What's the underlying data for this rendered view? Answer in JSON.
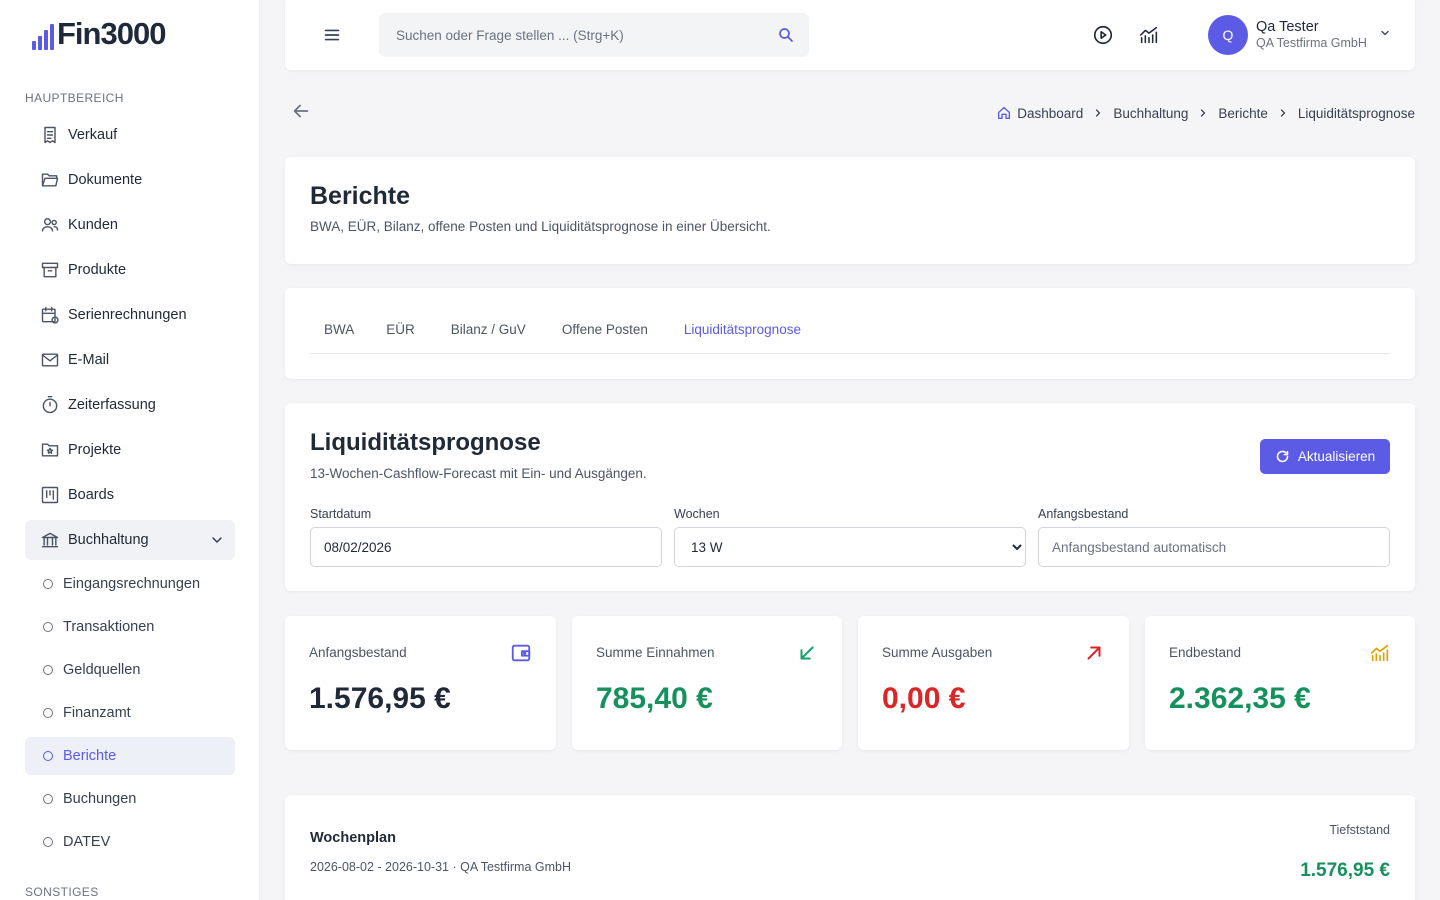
{
  "app": {
    "logo_text": "Fin3000"
  },
  "sidebar": {
    "section_main": "HAUPTBEREICH",
    "items": [
      {
        "label": "Verkauf"
      },
      {
        "label": "Dokumente"
      },
      {
        "label": "Kunden"
      },
      {
        "label": "Produkte"
      },
      {
        "label": "Serienrechnungen"
      },
      {
        "label": "E-Mail"
      },
      {
        "label": "Zeiterfassung"
      },
      {
        "label": "Projekte"
      },
      {
        "label": "Boards"
      },
      {
        "label": "Buchhaltung"
      }
    ],
    "sub_items": [
      {
        "label": "Eingangsrechnungen"
      },
      {
        "label": "Transaktionen"
      },
      {
        "label": "Geldquellen"
      },
      {
        "label": "Finanzamt"
      },
      {
        "label": "Berichte"
      },
      {
        "label": "Buchungen"
      },
      {
        "label": "DATEV"
      }
    ],
    "section_other": "SONSTIGES"
  },
  "topbar": {
    "search_placeholder": "Suchen oder Frage stellen ... (Strg+K)",
    "user": {
      "initial": "Q",
      "name": "Qa Tester",
      "company": "QA Testfirma GmbH"
    }
  },
  "breadcrumb": [
    "Dashboard",
    "Buchhaltung",
    "Berichte",
    "Liquiditätsprognose"
  ],
  "page": {
    "title": "Berichte",
    "subtitle": "BWA, EÜR, Bilanz, offene Posten und Liquiditätsprognose in einer Übersicht."
  },
  "tabs": [
    {
      "label": "BWA"
    },
    {
      "label": "EÜR"
    },
    {
      "label": "Bilanz / GuV"
    },
    {
      "label": "Offene Posten"
    },
    {
      "label": "Liquiditätsprognose",
      "active": true
    }
  ],
  "forecast": {
    "title": "Liquiditätsprognose",
    "subtitle": "13-Wochen-Cashflow-Forecast mit Ein- und Ausgängen.",
    "refresh_label": "Aktualisieren",
    "start_label": "Startdatum",
    "start_value": "08/02/2026",
    "weeks_label": "Wochen",
    "weeks_value": "13 W",
    "balance_label": "Anfangsbestand",
    "balance_placeholder": "Anfangsbestand automatisch"
  },
  "kpis": [
    {
      "label": "Anfangsbestand",
      "value": "1.576,95 €",
      "color": "#1f2937",
      "icon": "wallet-icon",
      "icon_color": "#5b5be6"
    },
    {
      "label": "Summe Einnahmen",
      "value": "785,40 €",
      "color": "#16905d",
      "icon": "arrow-down-left-icon",
      "icon_color": "#16a36b"
    },
    {
      "label": "Summe Ausgaben",
      "value": "0,00 €",
      "color": "#dc2626",
      "icon": "arrow-up-right-icon",
      "icon_color": "#dc2626"
    },
    {
      "label": "Endbestand",
      "value": "2.362,35 €",
      "color": "#16905d",
      "icon": "chart-line-icon",
      "icon_color": "#e0a100"
    }
  ],
  "weekplan": {
    "title": "Wochenplan",
    "subtitle": "2026-08-02 - 2026-10-31 · QA Testfirma GmbH",
    "low_label": "Tiefststand",
    "low_value": "1.576,95 €"
  }
}
